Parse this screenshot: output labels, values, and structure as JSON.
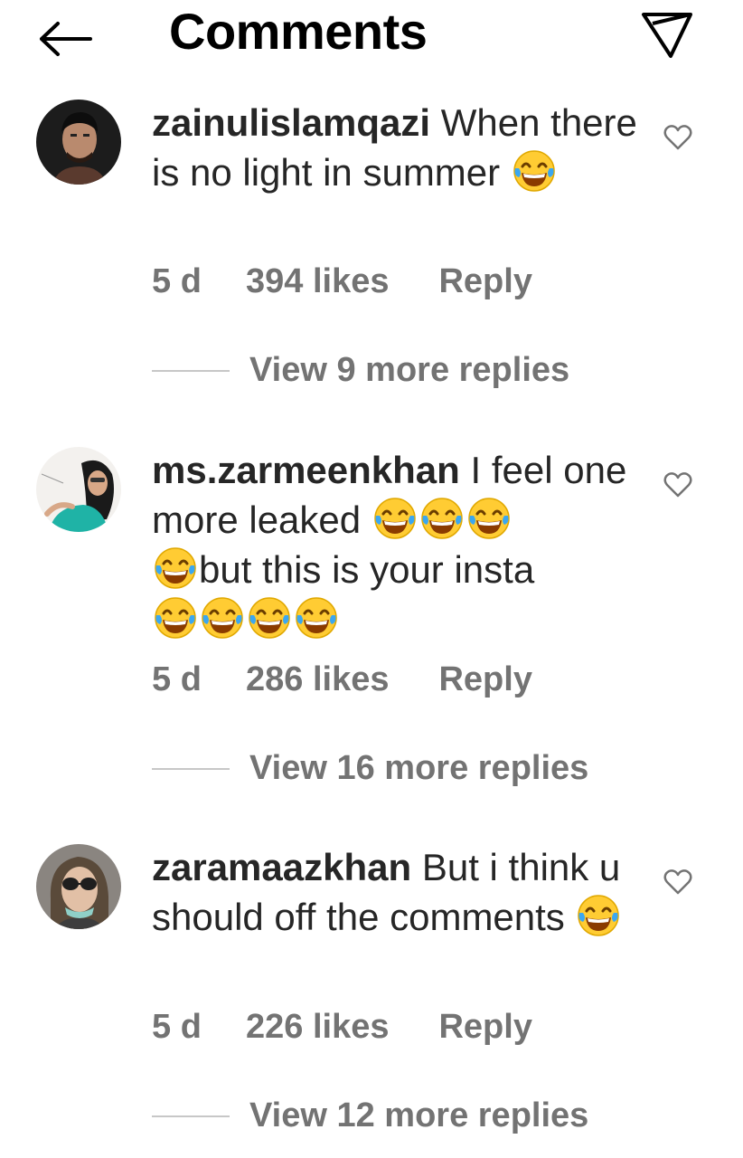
{
  "header": {
    "title": "Comments",
    "back_icon": "arrow-left-icon",
    "share_icon": "paper-plane-icon"
  },
  "colors": {
    "text": "#262626",
    "meta": "#737373",
    "divider": "#c7c7c7",
    "emoji_face": "#ffcc33"
  },
  "comments": [
    {
      "username": "zainulislamqazi",
      "text_before": " When there is no light in summer ",
      "text_after": "",
      "emojis": [
        "face-with-tears-of-joy"
      ],
      "time": "5 d",
      "likes": "394 likes",
      "reply_label": "Reply",
      "view_replies": "View 9 more replies"
    },
    {
      "username": "ms.zarmeenkhan",
      "text_before": " I feel one more leaked ",
      "text_after": "but this is your insta ",
      "emojis": [
        "face-with-tears-of-joy"
      ],
      "time": "5 d",
      "likes": "286 likes",
      "reply_label": "Reply",
      "view_replies": "View 16 more replies"
    },
    {
      "username": "zaramaazkhan",
      "text_before": " But i think u should off the comments ",
      "text_after": "",
      "emojis": [
        "face-with-tears-of-joy"
      ],
      "time": "5 d",
      "likes": "226 likes",
      "reply_label": "Reply",
      "view_replies": "View 12 more replies"
    }
  ]
}
